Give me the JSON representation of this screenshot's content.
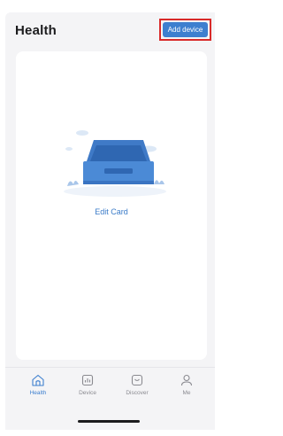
{
  "header": {
    "title": "Health",
    "add_device_label": "Add device"
  },
  "card": {
    "action_label": "Edit Card",
    "illustration_icon": "empty-tray-icon"
  },
  "tabbar": {
    "tabs": [
      {
        "label": "Health",
        "icon": "home-icon",
        "active": true
      },
      {
        "label": "Device",
        "icon": "device-icon",
        "active": false
      },
      {
        "label": "Discover",
        "icon": "discover-icon",
        "active": false
      },
      {
        "label": "Me",
        "icon": "person-icon",
        "active": false
      }
    ]
  },
  "colors": {
    "accent": "#3d7fcf",
    "highlight": "#d92a2a",
    "background": "#f4f4f6"
  }
}
